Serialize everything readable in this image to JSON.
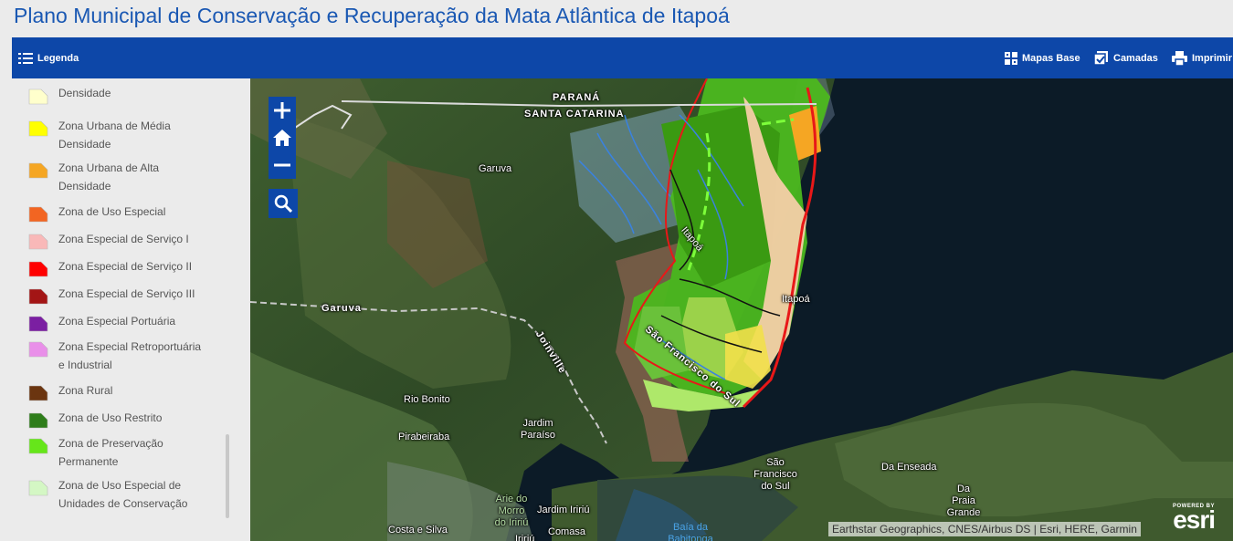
{
  "page": {
    "title": "Plano Municipal de Conservação e Recuperação da Mata Atlântica de Itapoá"
  },
  "toolbar": {
    "legend_label": "Legenda",
    "basemaps_label": "Mapas Base",
    "layers_label": "Camadas",
    "print_label": "Imprimir",
    "color": "#0d47a8"
  },
  "legend": {
    "items": [
      {
        "label_lines": [
          "Densidade"
        ],
        "color": "#ffffcc"
      },
      {
        "label_lines": [
          "Zona Urbana de Média",
          "Densidade"
        ],
        "color": "#ffff00"
      },
      {
        "label_lines": [
          "Zona Urbana de Alta",
          "Densidade"
        ],
        "color": "#f5a623"
      },
      {
        "label_lines": [
          "Zona de Uso Especial"
        ],
        "color": "#f26522"
      },
      {
        "label_lines": [
          "Zona Especial de Serviço I"
        ],
        "color": "#f9b8b8"
      },
      {
        "label_lines": [
          "Zona Especial de Serviço II"
        ],
        "color": "#ff0000"
      },
      {
        "label_lines": [
          "Zona Especial de Serviço III"
        ],
        "color": "#a31515"
      },
      {
        "label_lines": [
          "Zona Especial Portuária"
        ],
        "color": "#7b1fa2"
      },
      {
        "label_lines": [
          "Zona Especial Retroportuária",
          "e Industrial"
        ],
        "color": "#e98fe9"
      },
      {
        "label_lines": [
          "Zona Rural"
        ],
        "color": "#6b3510"
      },
      {
        "label_lines": [
          "Zona de Uso Restrito"
        ],
        "color": "#2e7d1a"
      },
      {
        "label_lines": [
          "Zona de Preservação",
          "Permanente"
        ],
        "color": "#66e61a"
      },
      {
        "label_lines": [
          "Zona de Uso Especial de",
          "Unidades de Conservação"
        ],
        "color": "#d4f7c4"
      }
    ]
  },
  "map": {
    "places": [
      {
        "text": "PARANÁ",
        "style": "bold"
      },
      {
        "text": "SANTA CATARINA",
        "style": "bold"
      },
      {
        "text": "Garuva",
        "style": "normal"
      },
      {
        "text": "Garuva",
        "style": "bold"
      },
      {
        "text": "Itapoá",
        "style": "normal"
      },
      {
        "text": "Itapoá",
        "style": "bold"
      },
      {
        "text": "Joinville",
        "style": "bold"
      },
      {
        "text": "São Francisco do Sul",
        "style": "bold"
      },
      {
        "text": "Rio Bonito",
        "style": "normal"
      },
      {
        "text": "Pirabeiraba",
        "style": "normal"
      },
      {
        "text": "Jardim Paraíso",
        "style": "normal"
      },
      {
        "text": "São Francisco do Sul",
        "style": "normal"
      },
      {
        "text": "Da Enseada",
        "style": "normal"
      },
      {
        "text": "Da Praia Grande",
        "style": "normal"
      },
      {
        "text": "Arie do Morro do Iririú",
        "style": "green"
      },
      {
        "text": "Jardim Iririú",
        "style": "normal"
      },
      {
        "text": "Costa e Silva",
        "style": "normal"
      },
      {
        "text": "Comasa",
        "style": "normal"
      },
      {
        "text": "Baía da Babitonga",
        "style": "water"
      },
      {
        "text": "Iririú",
        "style": "normal"
      }
    ],
    "attribution": "Earthstar Geographics, CNES/Airbus DS | Esri, HERE, Garmin",
    "esri_powered_by": "POWERED BY",
    "esri_logo": "esri"
  }
}
